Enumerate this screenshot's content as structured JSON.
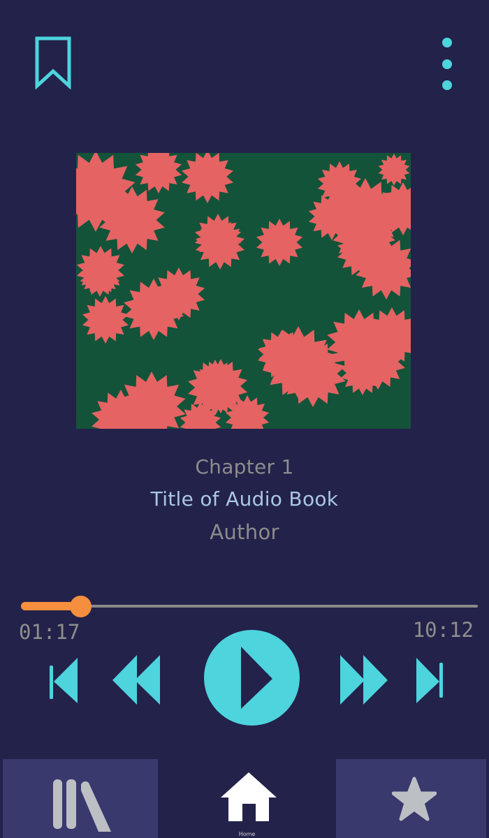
{
  "header": {
    "bookmark_icon": "bookmark-icon",
    "menu_icon": "more-vertical-icon"
  },
  "book": {
    "chapter": "Chapter 1",
    "title": "Title of Audio Book",
    "author": "Author"
  },
  "player": {
    "progress_fraction": 0.13,
    "current_time": "01:17",
    "total_time": "10:12",
    "controls": [
      "skip-back-icon",
      "rewind-icon",
      "play-icon",
      "fast-forward-icon",
      "skip-forward-icon"
    ]
  },
  "bottom_nav": {
    "items": [
      {
        "icon": "library-icon"
      },
      {
        "icon": "home-icon",
        "label": "Home"
      },
      {
        "icon": "star-icon"
      }
    ]
  },
  "colors": {
    "background": "#23224a",
    "accent": "#4dd4dd",
    "progress": "#f78f3f",
    "nav_tab": "#3a396e",
    "cover_dark": "#135339",
    "cover_light": "#e56363",
    "title_text": "#aac7e5",
    "secondary_text": "#8d8d8d"
  }
}
